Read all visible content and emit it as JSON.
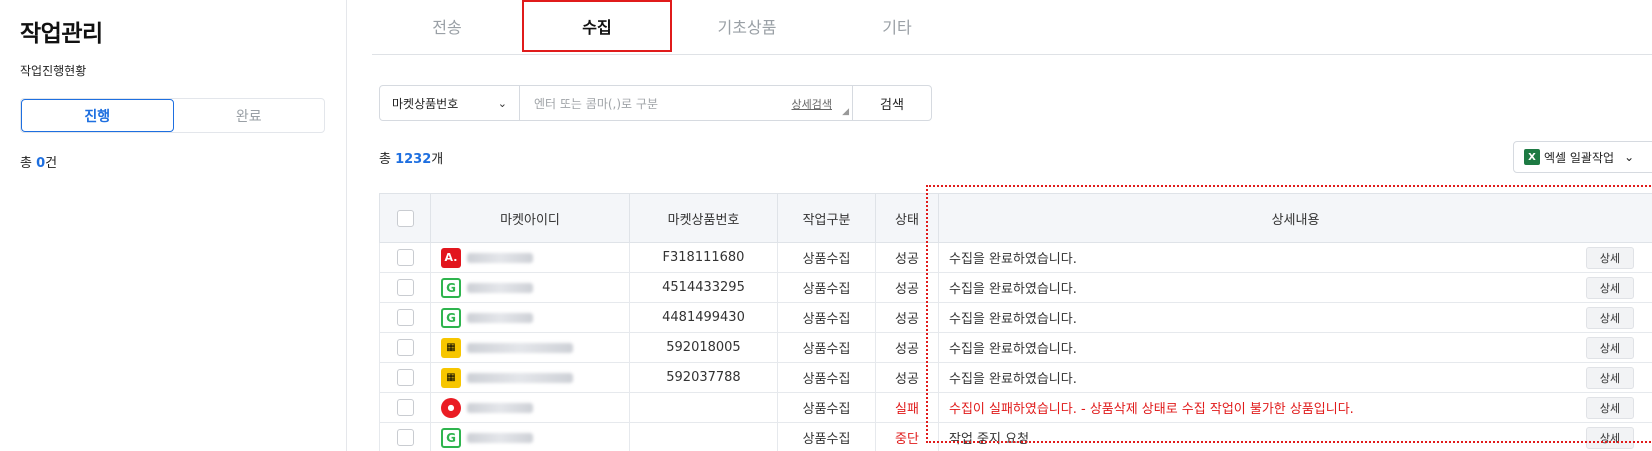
{
  "sidebar": {
    "title": "작업관리",
    "subtitle": "작업진행현황",
    "segments": [
      {
        "label": "진행",
        "active": true
      },
      {
        "label": "완료",
        "active": false
      }
    ],
    "total_prefix": "총 ",
    "total_count": "0",
    "total_suffix": "건"
  },
  "tabs": [
    {
      "label": "전송",
      "active": false
    },
    {
      "label": "수집",
      "active": true
    },
    {
      "label": "기초상품",
      "active": false
    },
    {
      "label": "기타",
      "active": false
    }
  ],
  "search": {
    "select_value": "마켓상품번호",
    "placeholder": "엔터 또는 콤마(,)로 구분",
    "detail_link": "상세검색",
    "button": "검색"
  },
  "summary": {
    "prefix": "총 ",
    "count": "1232",
    "suffix": "개"
  },
  "excel_button": {
    "icon_letter": "X",
    "label": "엑셀 일괄작업"
  },
  "table": {
    "headers": [
      "마켓아이디",
      "마켓상품번호",
      "작업구분",
      "상태",
      "상세내용"
    ],
    "detail_button_label": "상세",
    "rows": [
      {
        "market": "auction",
        "icon": "A.",
        "product_no": "F318111680",
        "job": "상품수집",
        "status": "성공",
        "status_fail": false,
        "detail": "수집을 완료하였습니다."
      },
      {
        "market": "gmarket",
        "icon": "G",
        "product_no": "4514433295",
        "job": "상품수집",
        "status": "성공",
        "status_fail": false,
        "detail": "수집을 완료하였습니다."
      },
      {
        "market": "gmarket",
        "icon": "G",
        "product_no": "4481499430",
        "job": "상품수집",
        "status": "성공",
        "status_fail": false,
        "detail": "수집을 완료하였습니다."
      },
      {
        "market": "coupang",
        "icon": "▦",
        "product_no": "592018005",
        "job": "상품수집",
        "status": "성공",
        "status_fail": false,
        "detail": "수집을 완료하였습니다."
      },
      {
        "market": "coupang",
        "icon": "▦",
        "product_no": "592037788",
        "job": "상품수집",
        "status": "성공",
        "status_fail": false,
        "detail": "수집을 완료하였습니다."
      },
      {
        "market": "eleven",
        "icon": "●",
        "product_no": "",
        "job": "상품수집",
        "status": "실패",
        "status_fail": true,
        "detail": "수집이 실패하였습니다. - 상품삭제 상태로 수집 작업이 불가한 상품입니다."
      },
      {
        "market": "gmarket",
        "icon": "G",
        "product_no": "",
        "job": "상품수집",
        "status": "중단",
        "status_fail": true,
        "detail": "작업 중지 요청"
      }
    ]
  },
  "colors": {
    "accent": "#1e6fe0",
    "highlight": "#e01b1b",
    "excel": "#1d7a43"
  }
}
